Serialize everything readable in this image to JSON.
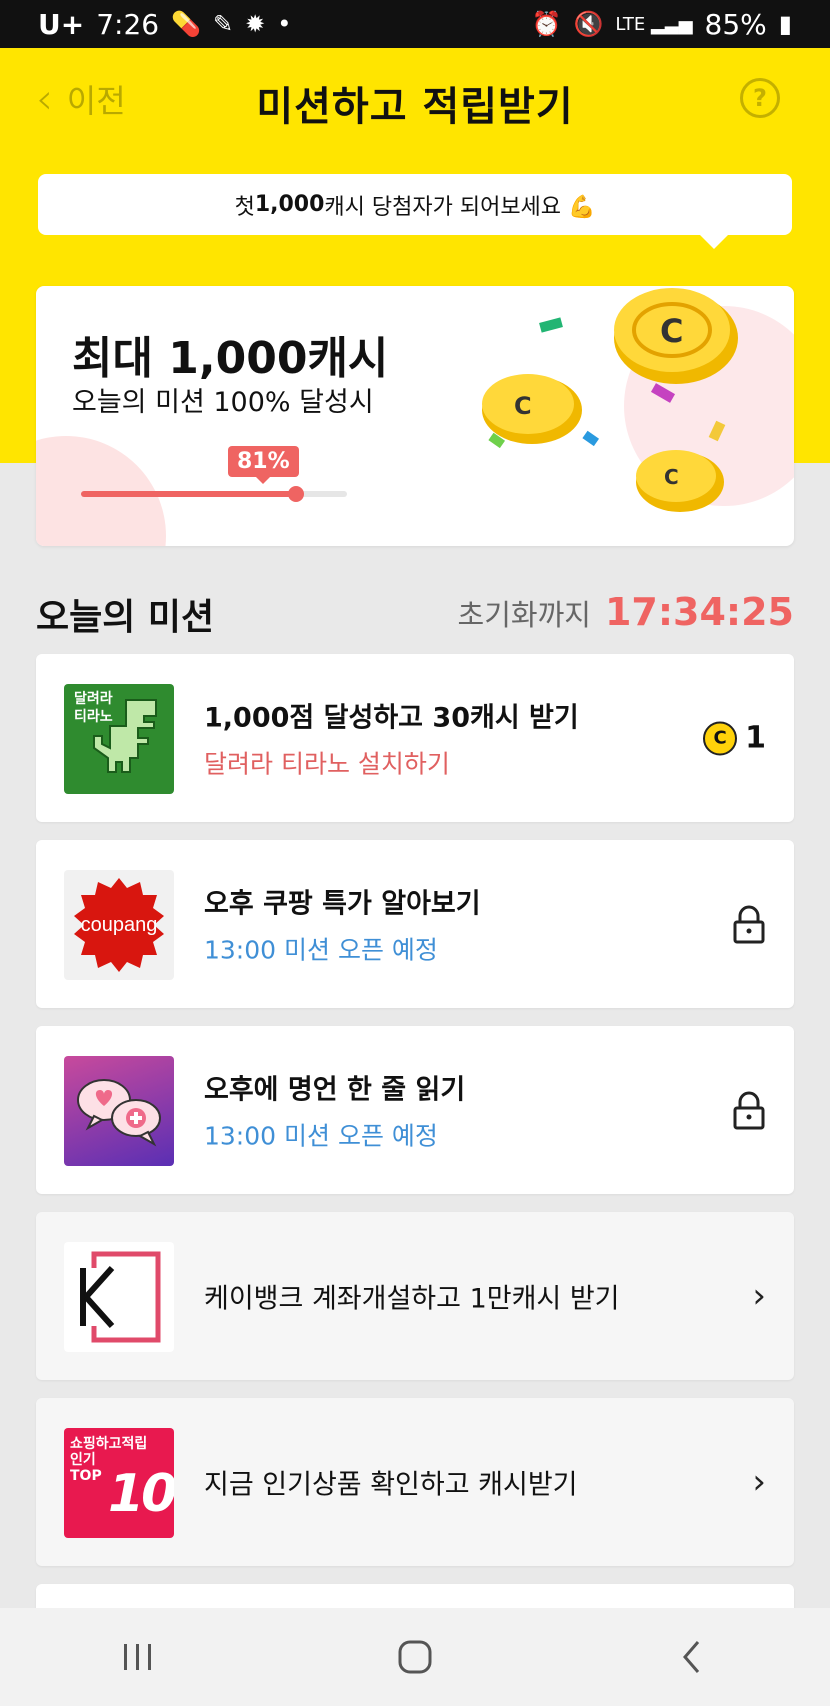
{
  "status_bar": {
    "carrier": "U+",
    "time": "7:26",
    "battery": "85%"
  },
  "header": {
    "back_label": "이전",
    "title": "미션하고 적립받기",
    "help_icon": "?"
  },
  "banner": {
    "prefix": "첫 ",
    "amount": "1,000",
    "suffix": "캐시 당첨자가 되어보세요 💪"
  },
  "hero": {
    "title": "최대 1,000캐시",
    "subtitle": "오늘의 미션 100% 달성시",
    "progress": 81,
    "progress_label": "81%"
  },
  "section": {
    "title": "오늘의 미션",
    "reset_label": "초기화까지",
    "reset_time": "17:34:25"
  },
  "missions": [
    {
      "title": "1,000점 달성하고 30캐시 받기",
      "subtitle": "달려라 티라노 설치하기",
      "thumb_text_1": "달려라",
      "thumb_text_2": "티라노",
      "coin_label": "C",
      "reward": "1"
    },
    {
      "title": "오후 쿠팡 특가 알아보기",
      "subtitle": "13:00 미션 오픈 예정",
      "thumb_text": "coupang"
    },
    {
      "title": "오후에 명언 한 줄 읽기",
      "subtitle": "13:00 미션 오픈 예정"
    },
    {
      "title": "케이뱅크 계좌개설하고 1만캐시 받기"
    },
    {
      "title": "지금 인기상품 확인하고 캐시받기",
      "thumb_text_1": "쇼핑하고적립",
      "thumb_text_2": "인기",
      "thumb_text_3": "TOP",
      "thumb_text_4": "10"
    }
  ],
  "colors": {
    "yellow": "#ffe500",
    "accent_red": "#ef6462",
    "link_blue": "#3f8fd6"
  }
}
